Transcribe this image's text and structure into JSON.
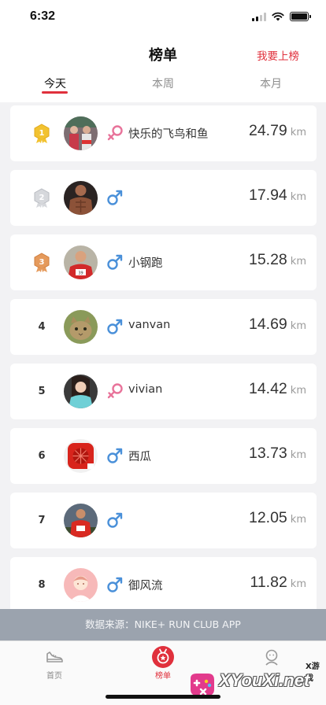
{
  "status_bar": {
    "time": "6:32"
  },
  "nav": {
    "title": "榜单",
    "action_label": "我要上榜"
  },
  "tabs": [
    {
      "label": "今天",
      "active": true
    },
    {
      "label": "本周",
      "active": false
    },
    {
      "label": "本月",
      "active": false
    }
  ],
  "leaderboard": [
    {
      "rank": "1",
      "medal": "gold",
      "gender": "female",
      "name": "快乐的飞鸟和鱼",
      "distance": "24.79",
      "unit": "km"
    },
    {
      "rank": "2",
      "medal": "silver",
      "gender": "male",
      "name": "",
      "distance": "17.94",
      "unit": "km"
    },
    {
      "rank": "3",
      "medal": "bronze",
      "gender": "male",
      "name": "小钢跑",
      "distance": "15.28",
      "unit": "km"
    },
    {
      "rank": "4",
      "medal": "",
      "gender": "male",
      "name": "vanvan",
      "distance": "14.69",
      "unit": "km"
    },
    {
      "rank": "5",
      "medal": "",
      "gender": "female",
      "name": "vivian",
      "distance": "14.42",
      "unit": "km"
    },
    {
      "rank": "6",
      "medal": "",
      "gender": "male",
      "name": "西瓜",
      "distance": "13.73",
      "unit": "km"
    },
    {
      "rank": "7",
      "medal": "",
      "gender": "male",
      "name": "",
      "distance": "12.05",
      "unit": "km"
    },
    {
      "rank": "8",
      "medal": "",
      "gender": "male",
      "name": "御风流",
      "distance": "11.82",
      "unit": "km"
    }
  ],
  "source_bar": {
    "text": "数据来源：NIKE+ RUN CLUB APP"
  },
  "tab_bar": [
    {
      "label": "首页",
      "icon": "shoe-icon",
      "active": false
    },
    {
      "label": "榜单",
      "icon": "medal-icon",
      "active": true
    },
    {
      "label": "",
      "icon": "person-icon",
      "active": false
    }
  ],
  "watermark": {
    "small_text": "X游戏",
    "brand_text": "XYouXi.net"
  },
  "colors": {
    "accent": "#e0303c",
    "male": "#4a90d9",
    "female": "#e8739a",
    "gold": "#f2c230",
    "silver": "#c9ccd1",
    "bronze": "#e59a5c",
    "source_bar": "#9ba3ae"
  }
}
